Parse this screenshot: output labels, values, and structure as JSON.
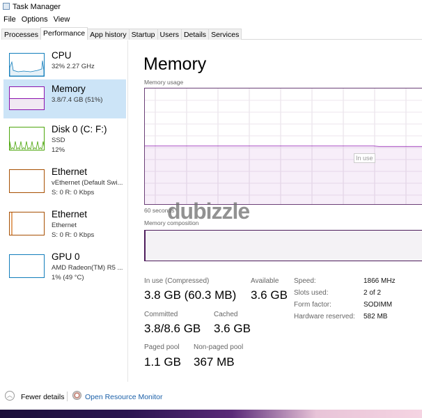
{
  "window": {
    "title": "Task Manager"
  },
  "menu": [
    "File",
    "Options",
    "View"
  ],
  "tabs": [
    "Processes",
    "Performance",
    "App history",
    "Startup",
    "Users",
    "Details",
    "Services"
  ],
  "active_tab": "Performance",
  "sidebar": [
    {
      "name": "CPU",
      "line1": "32% 2.27 GHz",
      "line2": "",
      "color": "#117dbb"
    },
    {
      "name": "Memory",
      "line1": "3.8/7.4 GB (51%)",
      "line2": "",
      "color": "#8b12ae",
      "selected": true
    },
    {
      "name": "Disk 0 (C: F:)",
      "line1": "SSD",
      "line2": "12%",
      "color": "#4da60c"
    },
    {
      "name": "Ethernet",
      "line1": "vEthernet (Default Swi...",
      "line2": "S: 0 R: 0 Kbps",
      "color": "#a74f01"
    },
    {
      "name": "Ethernet",
      "line1": "Ethernet",
      "line2": "S: 0 R: 0 Kbps",
      "color": "#a74f01"
    },
    {
      "name": "GPU 0",
      "line1": "AMD Radeon(TM) R5 ...",
      "line2": "1% (49 °C)",
      "color": "#117dbb"
    }
  ],
  "main": {
    "title": "Memory",
    "usage_label": "Memory usage",
    "usage_fraction": 0.51,
    "tooltip": "In use",
    "time_label": "60 seconds",
    "composition_label": "Memory composition",
    "stats": {
      "in_use_label": "In use (Compressed)",
      "in_use": "3.8 GB (60.3 MB)",
      "available_label": "Available",
      "available": "3.6 GB",
      "committed_label": "Committed",
      "committed": "3.8/8.6 GB",
      "cached_label": "Cached",
      "cached": "3.6 GB",
      "paged_label": "Paged pool",
      "paged": "1.1 GB",
      "nonpaged_label": "Non-paged pool",
      "nonpaged": "367 MB"
    },
    "specs": [
      {
        "label": "Speed:",
        "value": "1866 MHz"
      },
      {
        "label": "Slots used:",
        "value": "2 of 2"
      },
      {
        "label": "Form factor:",
        "value": "SODIMM"
      },
      {
        "label": "Hardware reserved:",
        "value": "582 MB"
      }
    ]
  },
  "footer": {
    "fewer": "Fewer details",
    "monitor": "Open Resource Monitor"
  },
  "watermark": "dubizzle"
}
